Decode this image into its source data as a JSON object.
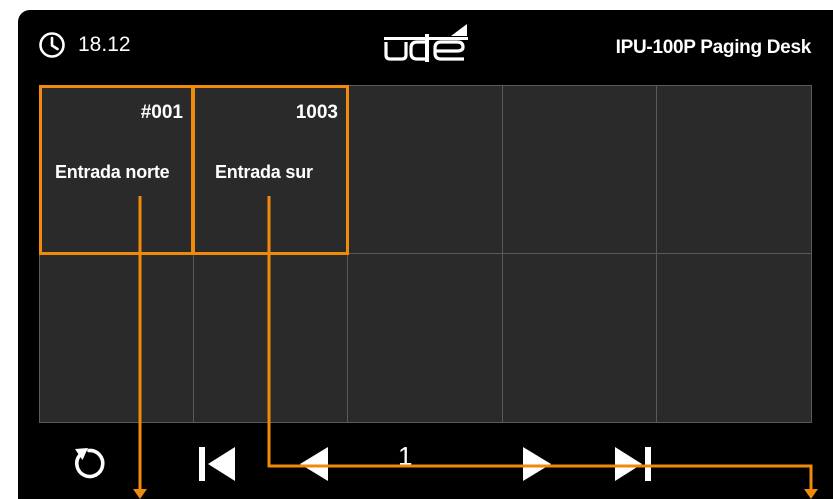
{
  "status_bar": {
    "time": "18.12",
    "clock_icon": "clock-icon",
    "logo_text": "ude",
    "title": "IPU-100P  Paging Desk"
  },
  "zones": [
    {
      "code": "#001",
      "name": "Entrada norte"
    },
    {
      "code": "1003",
      "name": "Entrada sur"
    }
  ],
  "grid": {
    "columns": 5,
    "rows": 2,
    "empty_cells": 8
  },
  "pager": {
    "current_page": "1",
    "buttons": [
      "reload-icon",
      "first-page-icon",
      "prev-page-icon",
      "next-page-icon",
      "last-page-icon"
    ]
  },
  "colors": {
    "background": "#000000",
    "cell": "#2a2a2a",
    "grid_line": "#5a5a5a",
    "accent": "#ef8a0a",
    "text": "#ffffff"
  }
}
